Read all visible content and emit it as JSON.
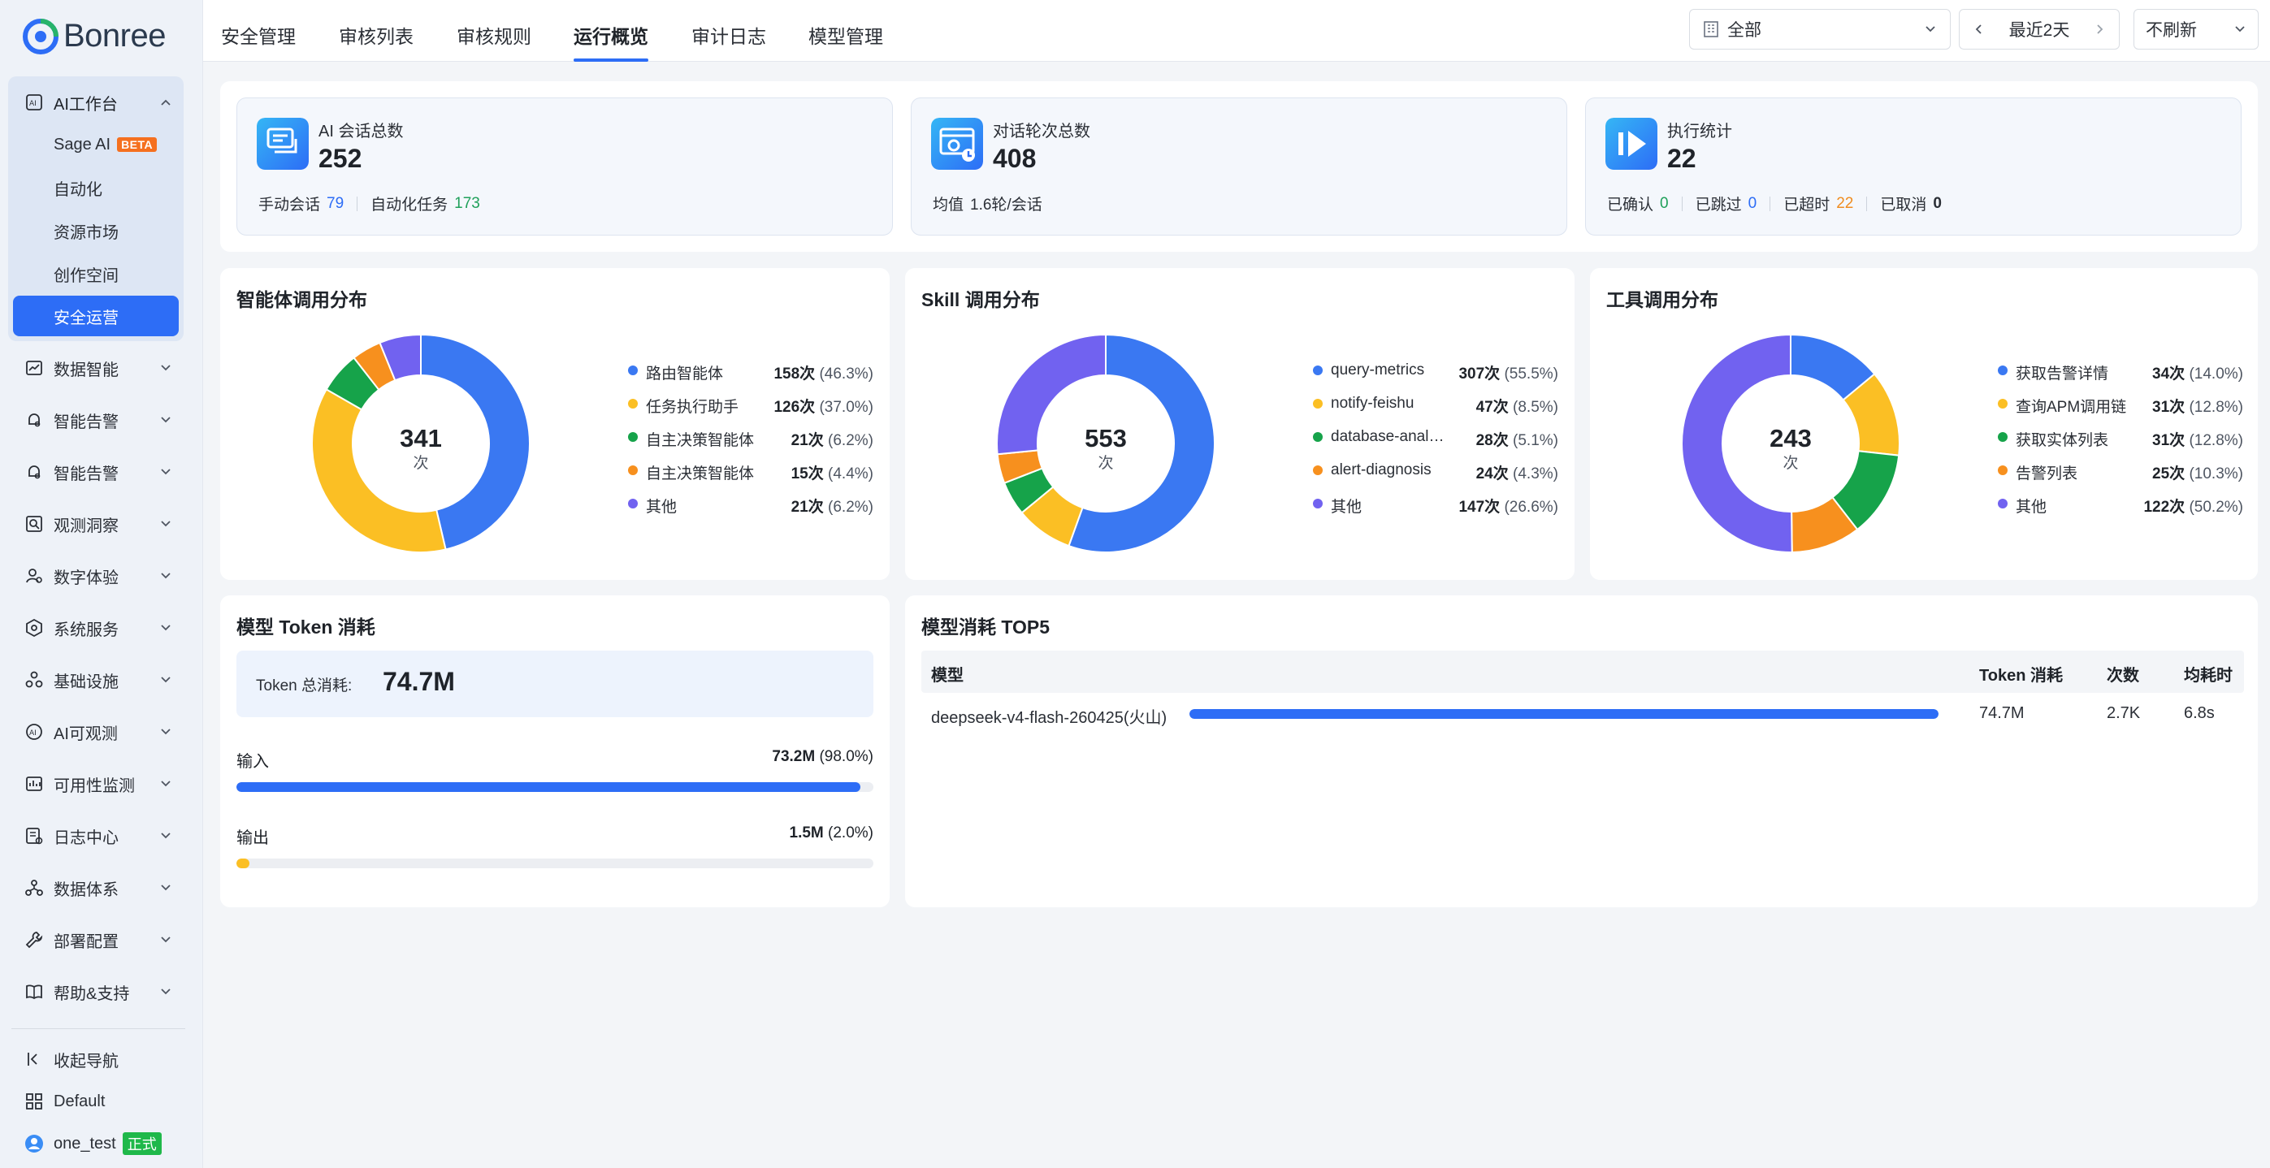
{
  "brand": {
    "name": "Bonree"
  },
  "sidebar": {
    "workspace": {
      "label": "AI工作台",
      "icon": "ai-workspace-icon"
    },
    "sub_items": [
      {
        "label": "Sage AI",
        "badge": "BETA"
      },
      {
        "label": "自动化"
      },
      {
        "label": "资源市场"
      },
      {
        "label": "创作空间"
      },
      {
        "label": "安全运营",
        "active": true
      }
    ],
    "items": [
      {
        "label": "数据智能",
        "icon": "chart-icon"
      },
      {
        "label": "智能告警",
        "icon": "bell-icon"
      },
      {
        "label": "智能告警",
        "icon": "bell-icon"
      },
      {
        "label": "观测洞察",
        "icon": "search-icon"
      },
      {
        "label": "数字体验",
        "icon": "user-icon"
      },
      {
        "label": "系统服务",
        "icon": "service-icon"
      },
      {
        "label": "基础设施",
        "icon": "infra-icon"
      },
      {
        "label": "AI可观测",
        "icon": "ai-observe-icon"
      },
      {
        "label": "可用性监测",
        "icon": "monitor-icon"
      },
      {
        "label": "日志中心",
        "icon": "log-icon"
      },
      {
        "label": "数据体系",
        "icon": "data-icon"
      },
      {
        "label": "部署配置",
        "icon": "wrench-icon"
      },
      {
        "label": "帮助&支持",
        "icon": "book-icon"
      }
    ],
    "footer": {
      "collapse": "收起导航",
      "space": "Default",
      "user": "one_test",
      "user_tag": "正式"
    }
  },
  "tabs": [
    {
      "label": "安全管理"
    },
    {
      "label": "审核列表"
    },
    {
      "label": "审核规则"
    },
    {
      "label": "运行概览",
      "active": true
    },
    {
      "label": "审计日志"
    },
    {
      "label": "模型管理"
    }
  ],
  "controls": {
    "scope": "全部",
    "range": "最近2天",
    "refresh": "不刷新"
  },
  "stats": [
    {
      "title": "AI 会话总数",
      "value": "252",
      "icon": "chat-icon",
      "meta": [
        {
          "label": "手动会话",
          "value": "79",
          "color": "blue"
        },
        {
          "label": "自动化任务",
          "value": "173",
          "color": "green"
        }
      ]
    },
    {
      "title": "对话轮次总数",
      "value": "408",
      "icon": "dialog-icon",
      "meta": [
        {
          "label": "均值",
          "value": "1.6轮/会话",
          "color": "plain"
        }
      ]
    },
    {
      "title": "执行统计",
      "value": "22",
      "icon": "play-icon",
      "meta": [
        {
          "label": "已确认",
          "value": "0",
          "color": "green"
        },
        {
          "label": "已跳过",
          "value": "0",
          "color": "blue"
        },
        {
          "label": "已超时",
          "value": "22",
          "color": "orange"
        },
        {
          "label": "已取消",
          "value": "0",
          "color": "plain"
        }
      ]
    }
  ],
  "charts": [
    {
      "title": "智能体调用分布",
      "total": "341",
      "unit": "次",
      "slices": [
        {
          "name": "路由智能体",
          "value": 158,
          "count": "158次",
          "pct": "(46.3%)",
          "color": "#3a78f2"
        },
        {
          "name": "任务执行助手",
          "value": 126,
          "count": "126次",
          "pct": "(37.0%)",
          "color": "#fbbf24"
        },
        {
          "name": "自主决策智能体",
          "value": 21,
          "count": "21次",
          "pct": "(6.2%)",
          "color": "#16a34a"
        },
        {
          "name": "自主决策智能体",
          "value": 15,
          "count": "15次",
          "pct": "(4.4%)",
          "color": "#f7901e"
        },
        {
          "name": "其他",
          "value": 21,
          "count": "21次",
          "pct": "(6.2%)",
          "color": "#7162f0"
        }
      ]
    },
    {
      "title": "Skill 调用分布",
      "total": "553",
      "unit": "次",
      "slices": [
        {
          "name": "query-metrics",
          "value": 307,
          "count": "307次",
          "pct": "(55.5%)",
          "color": "#3a78f2"
        },
        {
          "name": "notify-feishu",
          "value": 47,
          "count": "47次",
          "pct": "(8.5%)",
          "color": "#fbbf24"
        },
        {
          "name": "database-analysis",
          "value": 28,
          "count": "28次",
          "pct": "(5.1%)",
          "color": "#16a34a"
        },
        {
          "name": "alert-diagnosis",
          "value": 24,
          "count": "24次",
          "pct": "(4.3%)",
          "color": "#f7901e"
        },
        {
          "name": "其他",
          "value": 147,
          "count": "147次",
          "pct": "(26.6%)",
          "color": "#7162f0"
        }
      ]
    },
    {
      "title": "工具调用分布",
      "total": "243",
      "unit": "次",
      "slices": [
        {
          "name": "获取告警详情",
          "value": 34,
          "count": "34次",
          "pct": "(14.0%)",
          "color": "#3a78f2"
        },
        {
          "name": "查询APM调用链",
          "value": 31,
          "count": "31次",
          "pct": "(12.8%)",
          "color": "#fbbf24"
        },
        {
          "name": "获取实体列表",
          "value": 31,
          "count": "31次",
          "pct": "(12.8%)",
          "color": "#16a34a"
        },
        {
          "name": "告警列表",
          "value": 25,
          "count": "25次",
          "pct": "(10.3%)",
          "color": "#f7901e"
        },
        {
          "name": "其他",
          "value": 122,
          "count": "122次",
          "pct": "(50.2%)",
          "color": "#7162f0"
        }
      ]
    }
  ],
  "token": {
    "title": "模型 Token 消耗",
    "total_label": "Token 总消耗:",
    "total_value": "74.7M",
    "rows": [
      {
        "label": "输入",
        "value": "73.2M",
        "pct": "(98.0%)",
        "fraction": 0.98,
        "color": "#2d6df6"
      },
      {
        "label": "输出",
        "value": "1.5M",
        "pct": "(2.0%)",
        "fraction": 0.02,
        "color": "#fbbf24"
      }
    ]
  },
  "top5": {
    "title": "模型消耗 TOP5",
    "columns": [
      "模型",
      "Token 消耗",
      "次数",
      "均耗时"
    ],
    "rows": [
      {
        "model": "deepseek-v4-flash-260425(火山)",
        "token": "74.7M",
        "count": "2.7K",
        "avg": "6.8s",
        "fraction": 1.0
      }
    ]
  }
}
